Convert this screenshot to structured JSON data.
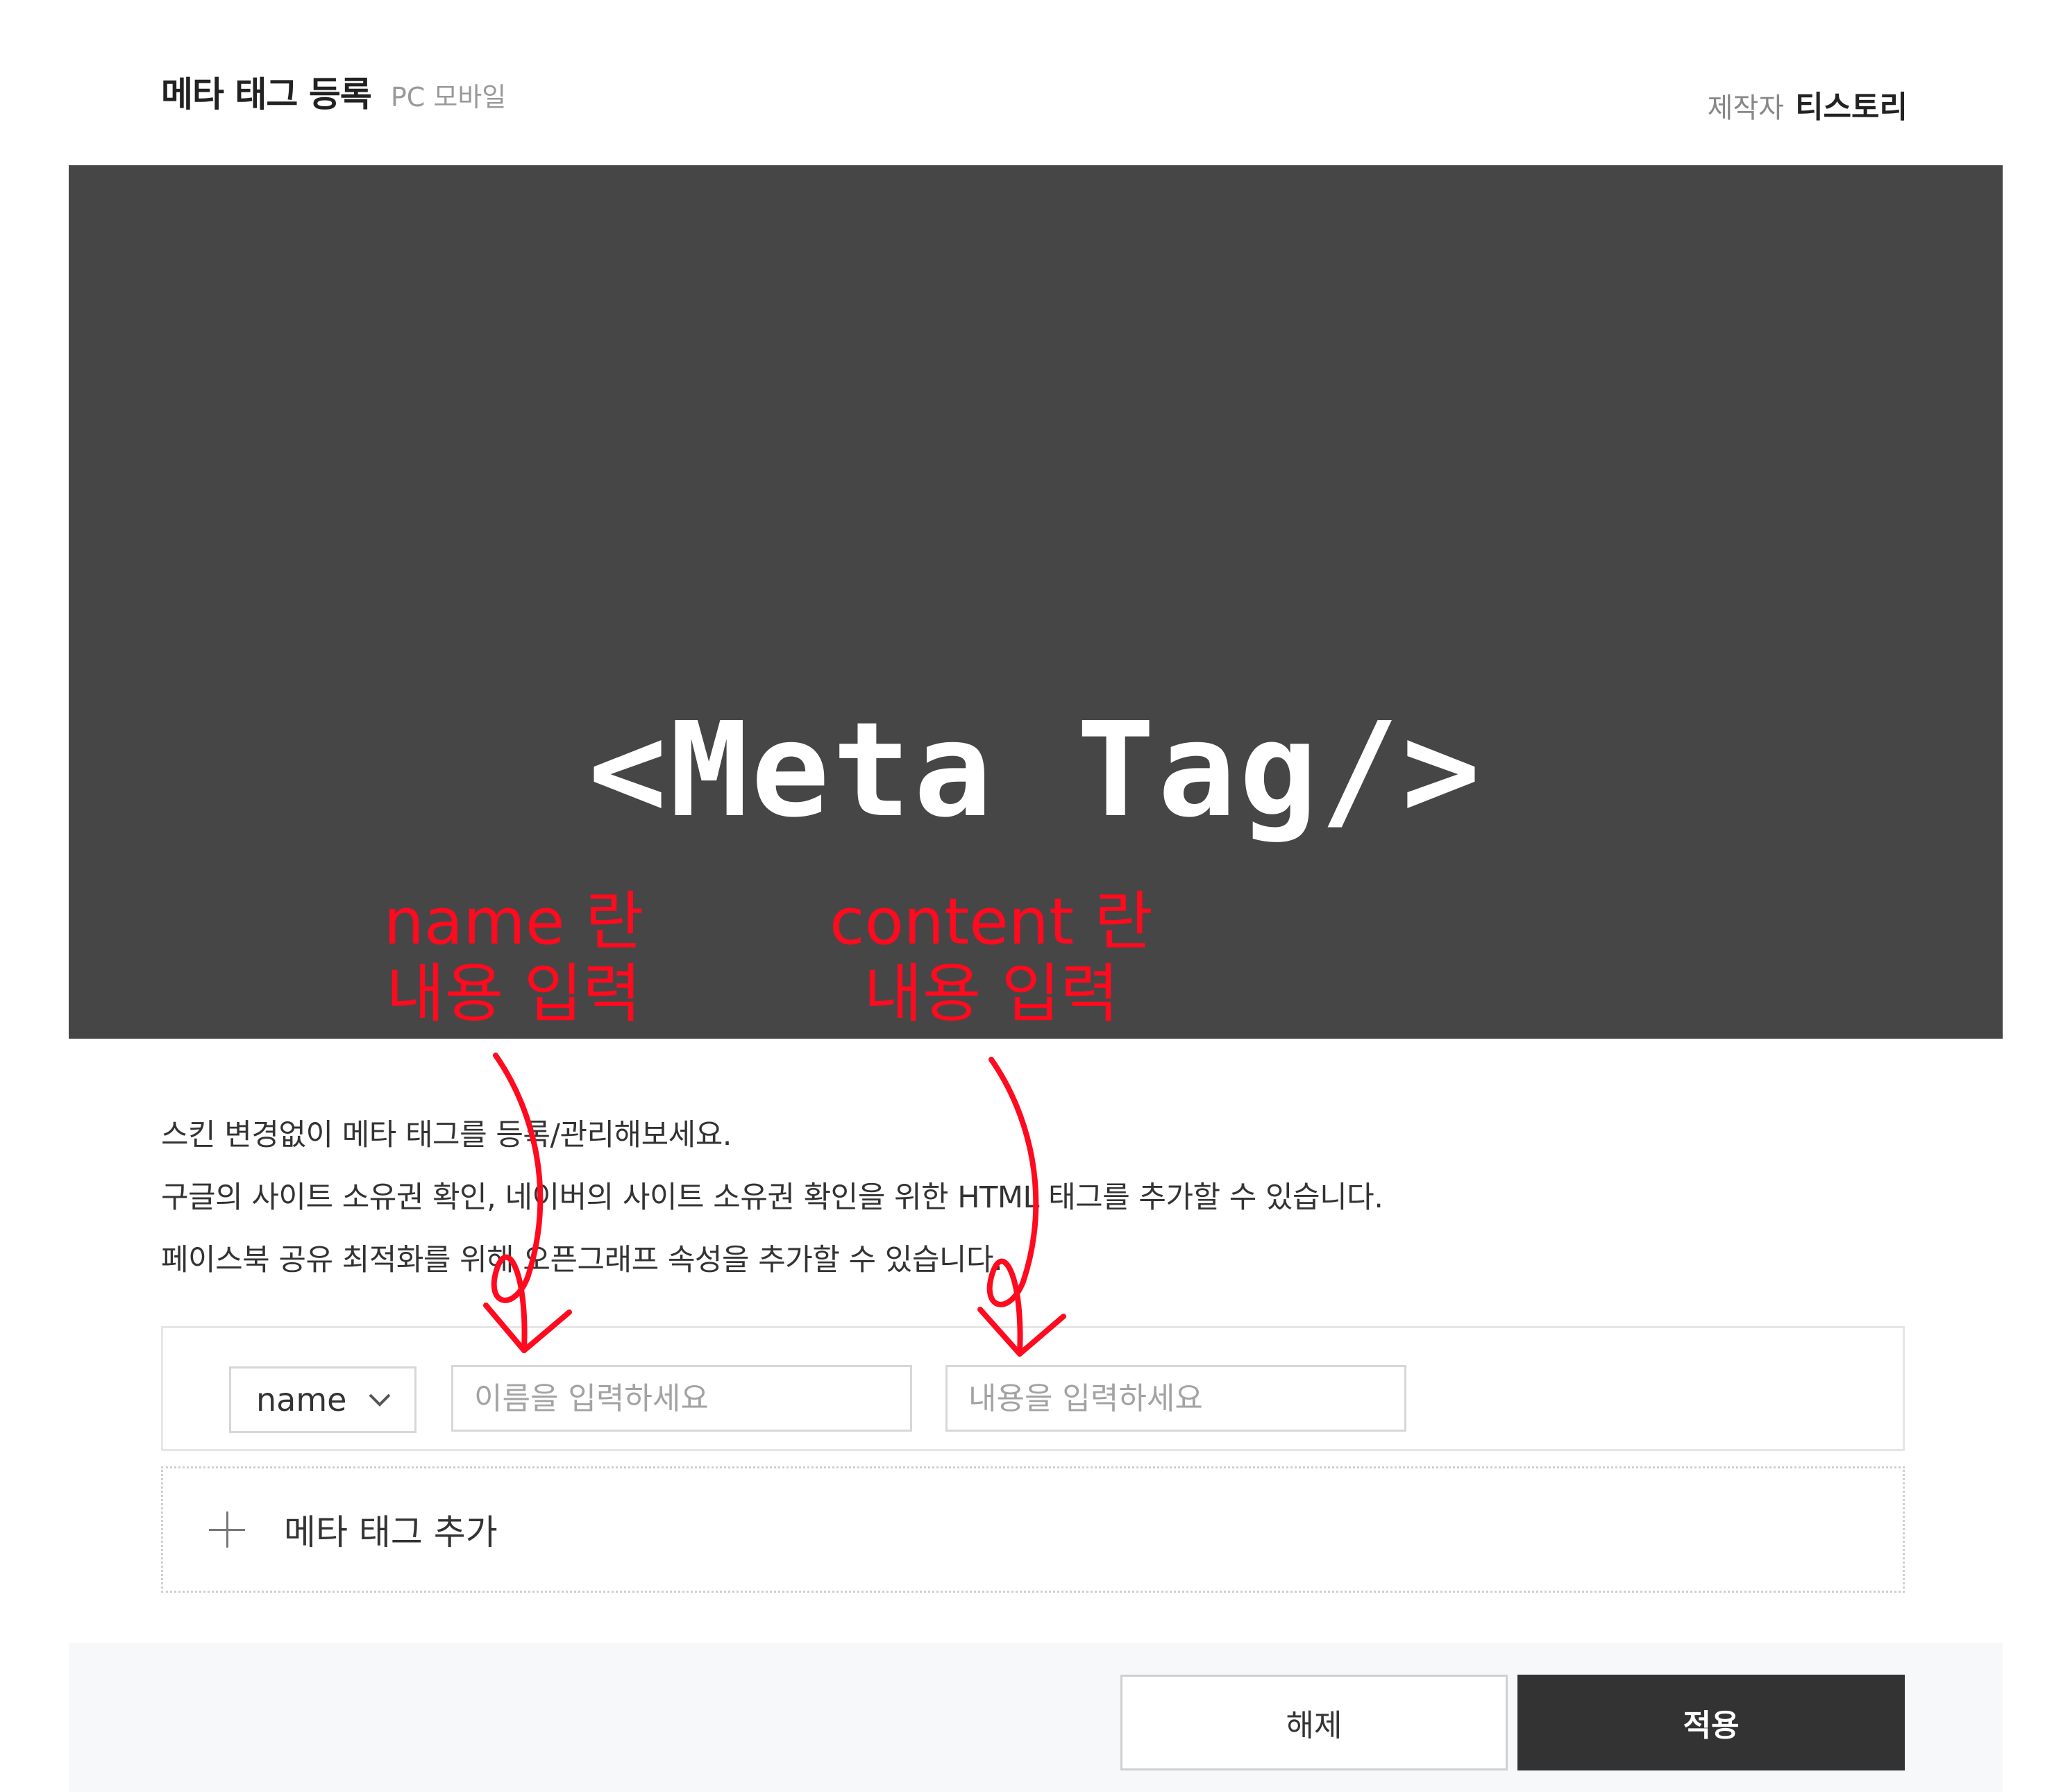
{
  "header": {
    "title": "메타 태그 등록",
    "devices": "PC 모바일",
    "maker_label": "제작자",
    "maker_name": "티스토리"
  },
  "banner": {
    "text": "<Meta Tag/>",
    "background_color": "#464646"
  },
  "annotations": {
    "name": [
      "name 란",
      "내용 입력"
    ],
    "content": [
      "content 란",
      "내용 입력"
    ],
    "color": "#ff0a1e"
  },
  "description": [
    "스킨 변경없이 메타 태그를 등록/관리해보세요.",
    "구글의 사이트 소유권 확인, 네이버의 사이트 소유권 확인을 위한 HTML 태그를 추가할 수 있습니다.",
    "페이스북 공유 최적화를 위해 오픈그래프 속성을 추가할 수 있습니다."
  ],
  "form": {
    "type_select": "name",
    "name_placeholder": "이름을 입력하세요",
    "content_placeholder": "내용을 입력하세요"
  },
  "add_row": {
    "label": "메타 태그 추가",
    "icon": "plus-icon"
  },
  "buttons": {
    "cancel": "해제",
    "apply": "적용"
  }
}
